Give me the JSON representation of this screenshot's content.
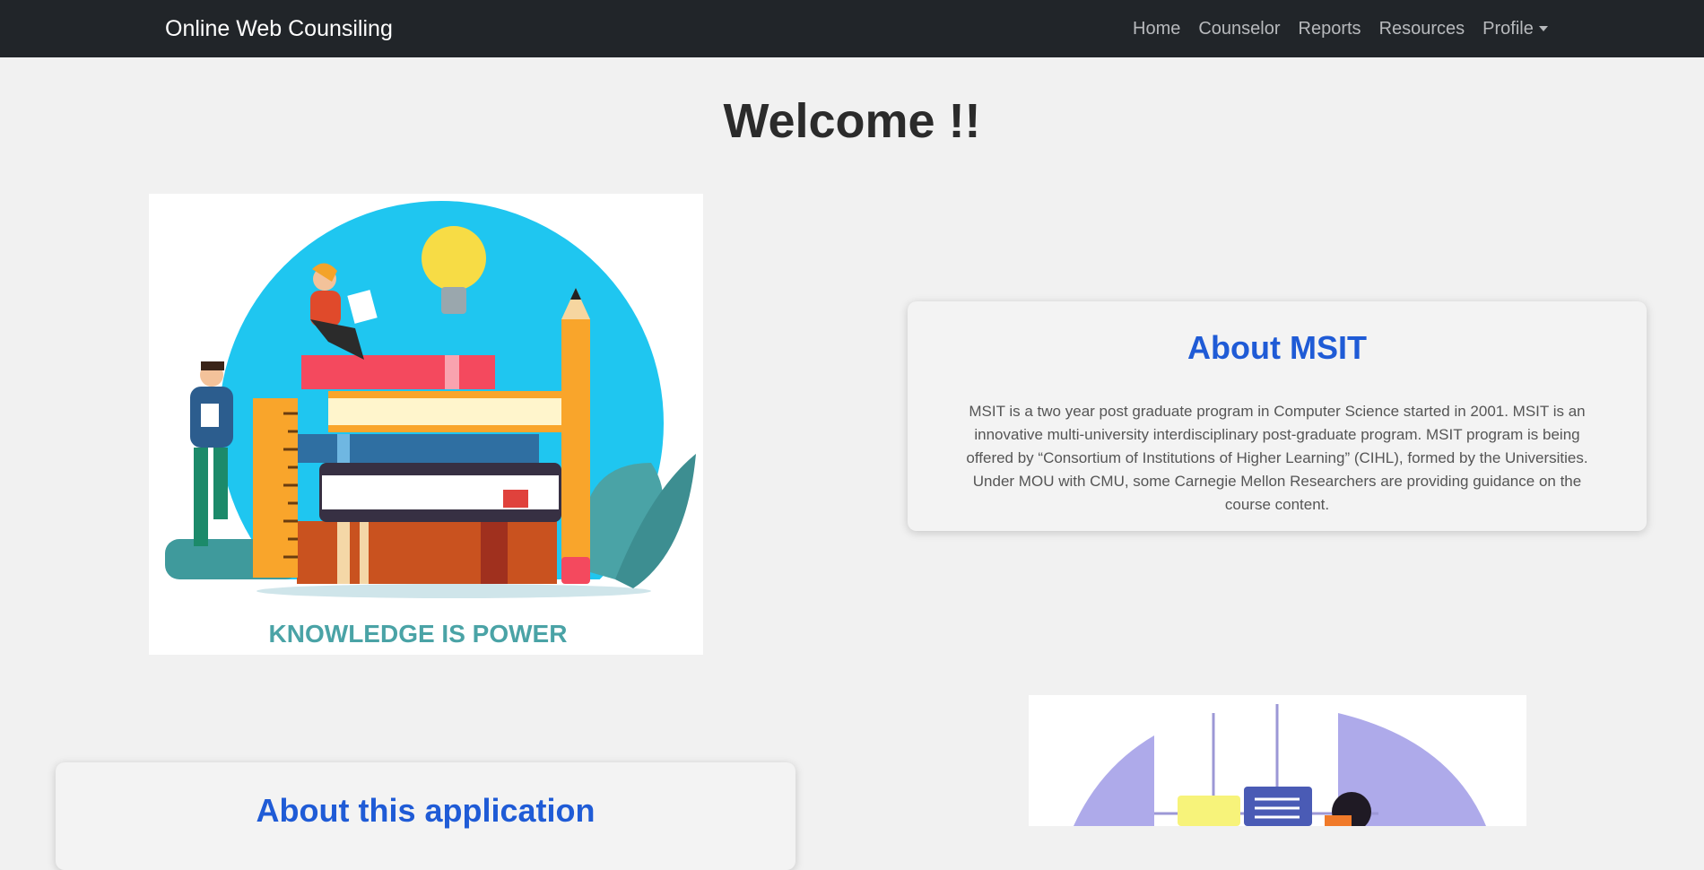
{
  "navbar": {
    "brand": "Online Web Counsiling",
    "links": [
      "Home",
      "Counselor",
      "Reports",
      "Resources",
      "Profile"
    ]
  },
  "main": {
    "heading": "Welcome !!"
  },
  "illustration1": {
    "caption": "KNOWLEDGE IS POWER"
  },
  "about_msit": {
    "title": "About MSIT",
    "text": "MSIT is a two year post graduate program in Computer Science started in 2001. MSIT is an innovative multi-university interdisciplinary post-graduate program. MSIT program is being offered by “Consortium of Institutions of Higher Learning” (CIHL), formed by the Universities. Under MOU with CMU, some Carnegie Mellon Researchers are providing guidance on the course content."
  },
  "about_app": {
    "title": "About this application"
  },
  "colors": {
    "navbar_bg": "#212529",
    "accent_title": "#1f5bd6",
    "page_bg": "#f1f1f1"
  }
}
